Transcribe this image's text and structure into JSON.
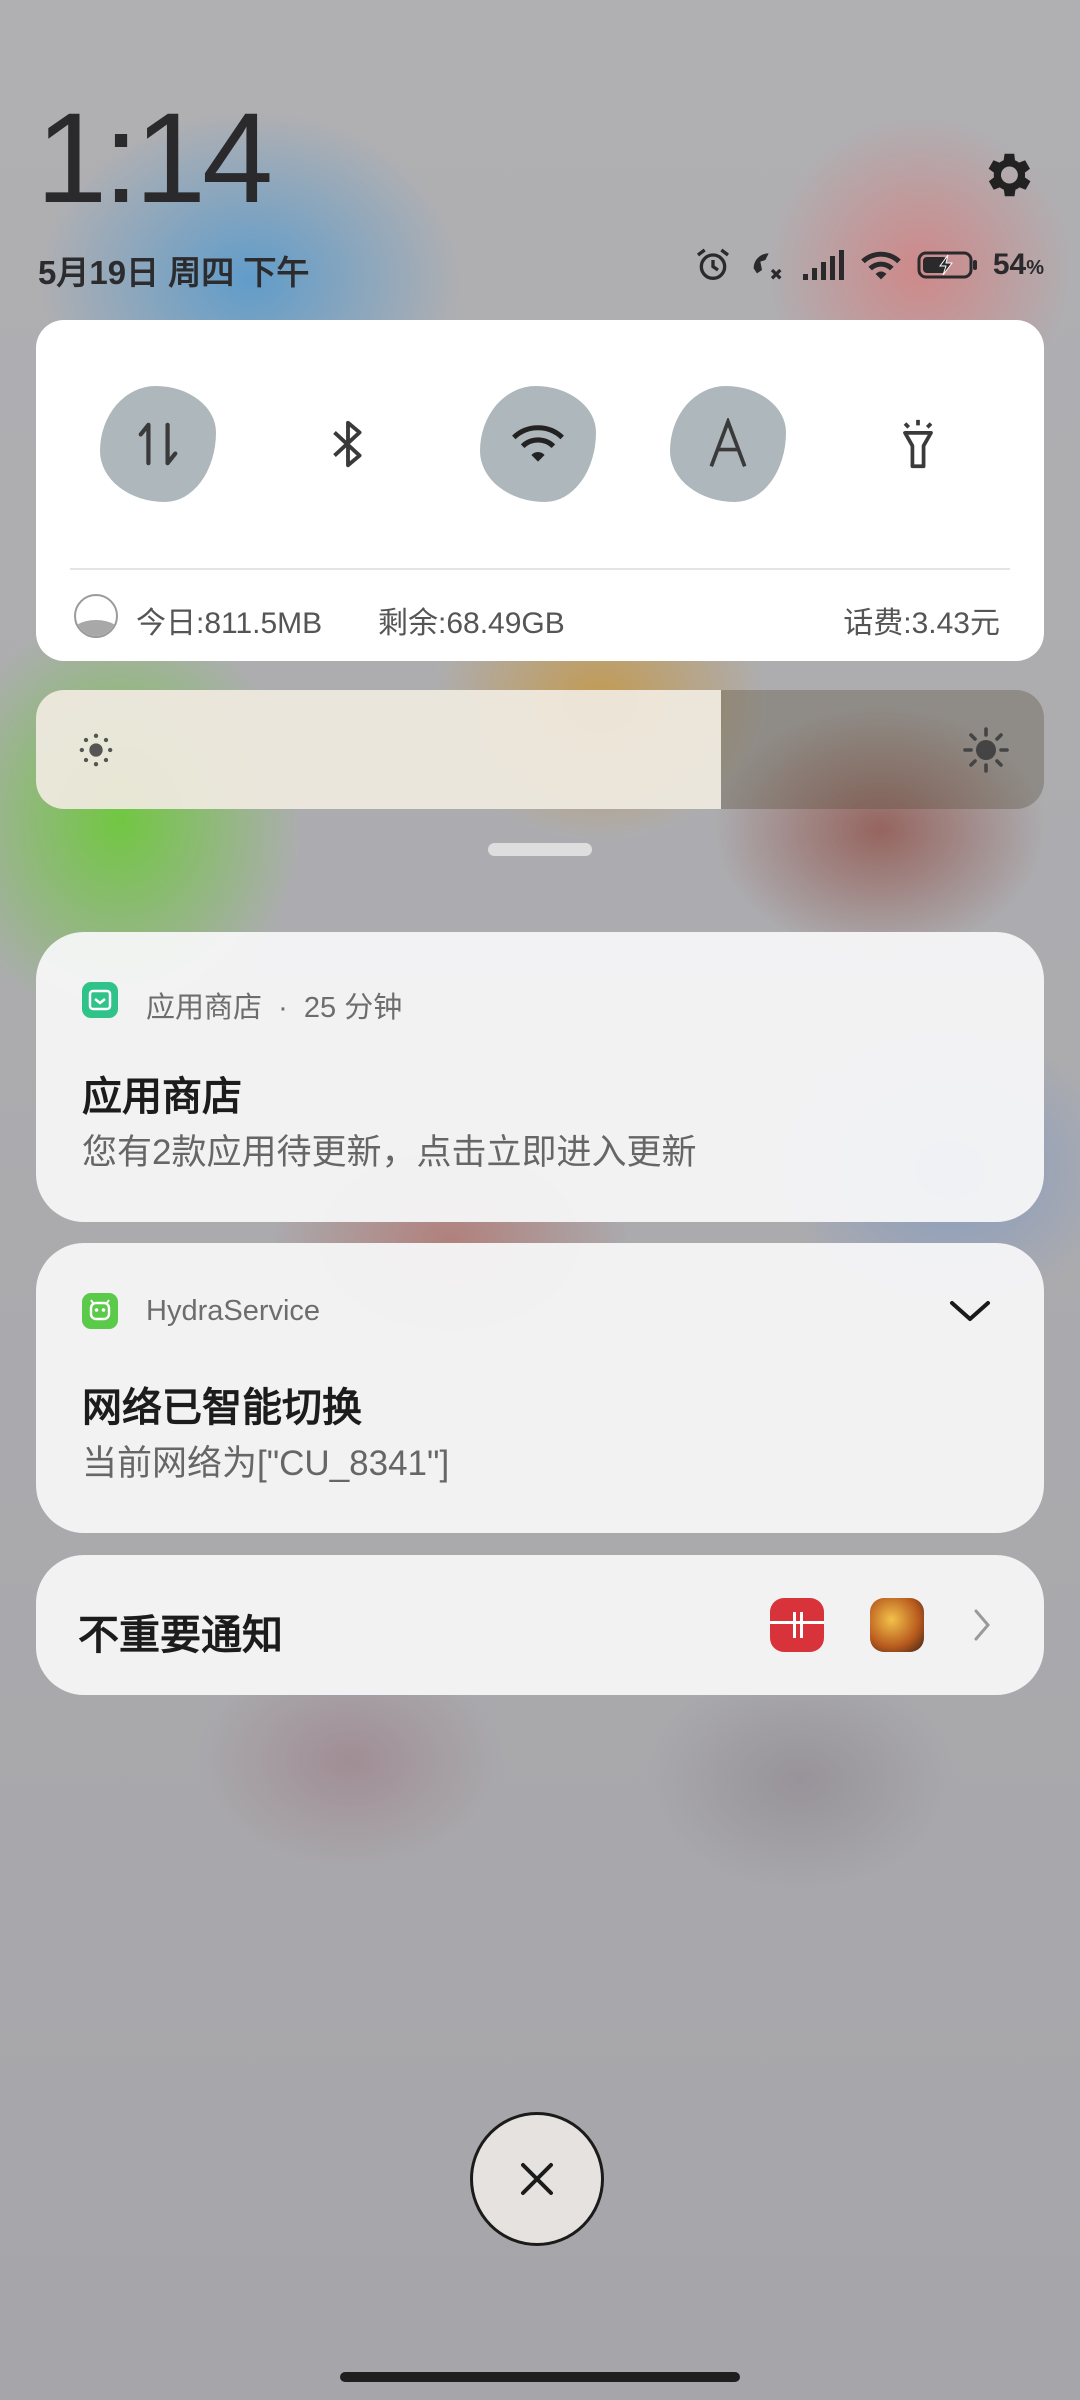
{
  "status": {
    "time": "1:14",
    "date": "5月19日 周四 下午",
    "battery_percent": "54",
    "battery_unit": "%"
  },
  "quick_settings": {
    "tiles": [
      {
        "icon": "mobile-data-icon",
        "active": true
      },
      {
        "icon": "bluetooth-icon",
        "active": false
      },
      {
        "icon": "wifi-icon",
        "active": true
      },
      {
        "icon": "auto-brightness-icon",
        "active": true
      },
      {
        "icon": "flashlight-icon",
        "active": false
      }
    ],
    "data_today": "今日:811.5MB",
    "data_remaining": "剩余:68.49GB",
    "balance": "话费:3.43元"
  },
  "brightness": {
    "level": 0.68
  },
  "notifications": [
    {
      "app": "应用商店",
      "time": "25 分钟",
      "title": "应用商店",
      "body": "您有2款应用待更新，点击立即进入更新",
      "icon_color": "#2fc38a"
    },
    {
      "app": "HydraService",
      "title": "网络已智能切换",
      "body": "当前网络为[\"CU_8341\"]",
      "icon_color": "#5bc94a"
    }
  ],
  "unimportant": {
    "label": "不重要通知"
  },
  "colors": {
    "accent": "#aeb7bb",
    "card_bg": "#f6f6f8"
  }
}
